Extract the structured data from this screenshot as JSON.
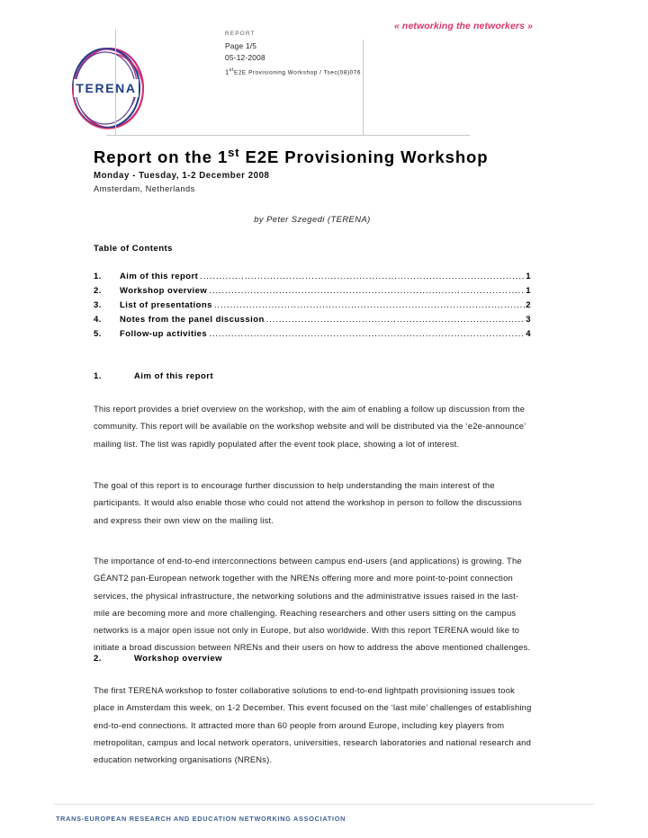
{
  "header": {
    "tagline": "« networking the networkers »",
    "doc_type": "REPORT",
    "page_label": "Page 1/5",
    "date": "05-12-2008",
    "reference_prefix": "1",
    "reference_sup": "st",
    "reference_rest": "E2E Provisioning Workshop / Tsec(08)076",
    "logo_text": "TERENA",
    "logo_color_magenta": "#c9247d",
    "logo_color_navy": "#1f3d87",
    "logo_color_crimson": "#d6376c"
  },
  "title": {
    "prefix": "Report on the 1",
    "sup": "st",
    "rest": " E2E Provisioning Workshop",
    "subtitle": "Monday - Tuesday, 1-2 December 2008",
    "location": "Amsterdam, Netherlands",
    "byline": "by Peter Szegedi (TERENA)"
  },
  "toc": {
    "heading": "Table of Contents",
    "dots": "..........................................................................................................................................................",
    "entries": [
      {
        "num": "1.",
        "label": "Aim of this report",
        "page": "1"
      },
      {
        "num": "2.",
        "label": "Workshop overview",
        "page": "1"
      },
      {
        "num": "3.",
        "label": "List of presentations",
        "page": "2"
      },
      {
        "num": "4.",
        "label": "Notes from the panel discussion",
        "page": "3"
      },
      {
        "num": "5.",
        "label": "Follow-up activities",
        "page": "4"
      }
    ]
  },
  "sections": [
    {
      "num": "1.",
      "title": "Aim of this report",
      "paragraphs": [
        "This report provides a brief overview on the workshop, with the aim of enabling a follow up discussion from the community. This report will be available on the workshop website and will be distributed via the ‘e2e-announce’ mailing list. The list was rapidly populated after the event took place, showing a lot of interest.",
        "The goal of this report is to encourage further discussion to help understanding the main interest of the participants. It would also enable those who could not attend the workshop in person to follow the discussions and express their own view on the mailing list.",
        "The importance of end-to-end interconnections between campus end-users (and applications) is growing. The GÉANT2 pan-European network together with the NRENs offering more and more point-to-point connection services, the physical infrastructure, the networking solutions and the administrative issues raised in the last-mile are becoming more and more challenging. Reaching researchers and other users sitting on the campus networks is a major open issue not only in Europe, but also worldwide. With this report TERENA would like to initiate a broad discussion between NRENs and their users on how to address the above mentioned challenges."
      ]
    },
    {
      "num": "2.",
      "title": "Workshop overview",
      "paragraphs": [
        "The first TERENA workshop to foster collaborative solutions to end-to-end lightpath provisioning issues took place in Amsterdam this week, on 1-2 December. This event focused on the ‘last mile’ challenges of establishing end-to-end connections. It attracted more than 60 people from around Europe, including key players from metropolitan, campus and local network operators, universities, research laboratories and national research and education networking organisations (NRENs)."
      ]
    }
  ],
  "footer": {
    "text": "TRANS-EUROPEAN RESEARCH AND EDUCATION NETWORKING ASSOCIATION",
    "color": "#3f6096"
  }
}
